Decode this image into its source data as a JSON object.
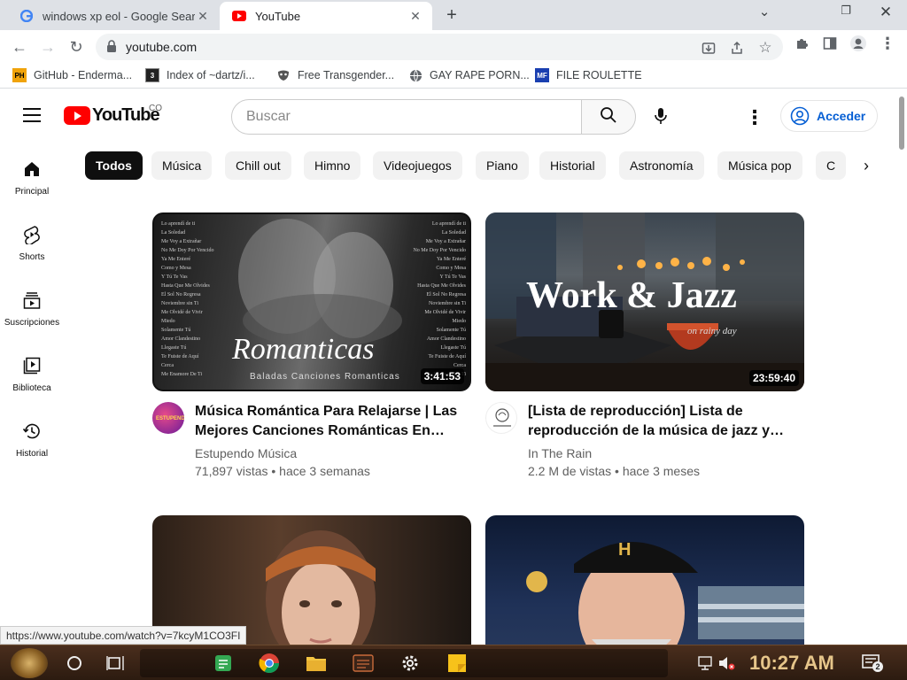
{
  "browser": {
    "tabs": [
      {
        "title": "windows xp eol - Google Search",
        "active": false
      },
      {
        "title": "YouTube",
        "active": true
      }
    ],
    "new_tab": "+",
    "url": "youtube.com",
    "bookmarks": [
      {
        "label": "GitHub - Enderma...",
        "icon": "ph-icon"
      },
      {
        "label": "Index of ~dartz/i...",
        "icon": "page-icon"
      },
      {
        "label": "Free Transgender...",
        "icon": "mask-icon"
      },
      {
        "label": "GAY RAPE PORN...",
        "icon": "globe-icon"
      },
      {
        "label": "FILE ROULETTE",
        "icon": "file-roulette-icon"
      }
    ]
  },
  "youtube": {
    "logo_text": "YouTube",
    "country_code": "CO",
    "search_placeholder": "Buscar",
    "signin_label": "Acceder",
    "sidebar": [
      {
        "label": "Principal",
        "icon": "home-icon"
      },
      {
        "label": "Shorts",
        "icon": "shorts-icon"
      },
      {
        "label": "Suscripciones",
        "icon": "subscriptions-icon"
      },
      {
        "label": "Biblioteca",
        "icon": "library-icon"
      },
      {
        "label": "Historial",
        "icon": "history-icon"
      }
    ],
    "chips": [
      "Todos",
      "Música",
      "Chill out",
      "Himno",
      "Videojuegos",
      "Piano",
      "Historial",
      "Astronomía",
      "Música pop",
      "C"
    ],
    "active_chip": "Todos",
    "videos": [
      {
        "title": "Música Romántica Para Relajarse | Las Mejores Canciones Románticas En Es...",
        "channel": "Estupendo Música",
        "stats": "71,897 vistas • hace 3 semanas",
        "duration": "3:41:53",
        "thumb_text": "Romanticas",
        "thumb_sub": "Baladas Canciones Romanticas"
      },
      {
        "title": "[Lista de reproducción] Lista de reproducción de la música de jazz y la...",
        "channel": "In The Rain",
        "stats": "2.2 M de vistas • hace 3 meses",
        "duration": "23:59:40",
        "thumb_text": "Work & Jazz",
        "thumb_sub": "on rainy day"
      },
      {
        "title": "",
        "channel": "",
        "stats": ""
      },
      {
        "title": "",
        "channel": "",
        "stats": ""
      }
    ]
  },
  "status_url": "https://www.youtube.com/watch?v=7kcyM1CO3FI",
  "taskbar": {
    "clock": "10:27 AM",
    "notification_count": "2"
  },
  "colors": {
    "yt_red": "#ff0000",
    "link_blue": "#065fd4",
    "chip_bg": "#f2f2f2",
    "chip_active": "#0f0f0f"
  }
}
